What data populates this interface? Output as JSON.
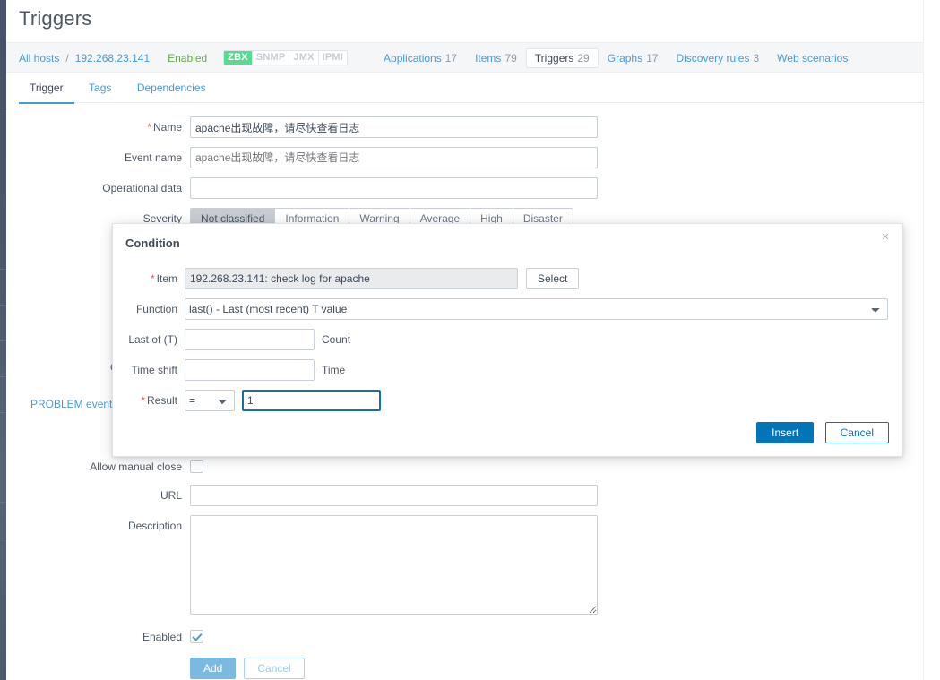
{
  "page": {
    "title": "Triggers"
  },
  "hostbar": {
    "all_hosts": "All hosts",
    "separator": "/",
    "host": "192.268.23.141",
    "status": "Enabled",
    "interfaces": [
      {
        "label": "ZBX",
        "active": true
      },
      {
        "label": "SNMP",
        "active": false
      },
      {
        "label": "JMX",
        "active": false
      },
      {
        "label": "IPMI",
        "active": false
      }
    ],
    "nav": [
      {
        "label": "Applications",
        "count": "17",
        "selected": false
      },
      {
        "label": "Items",
        "count": "79",
        "selected": false
      },
      {
        "label": "Triggers",
        "count": "29",
        "selected": true
      },
      {
        "label": "Graphs",
        "count": "17",
        "selected": false
      },
      {
        "label": "Discovery rules",
        "count": "3",
        "selected": false
      },
      {
        "label": "Web scenarios",
        "count": "",
        "selected": false
      }
    ]
  },
  "tabs": [
    {
      "label": "Trigger",
      "active": true
    },
    {
      "label": "Tags",
      "active": false
    },
    {
      "label": "Dependencies",
      "active": false
    }
  ],
  "form": {
    "name_label": "Name",
    "name_value": "apache出现故障，请尽快查看日志",
    "event_name_label": "Event name",
    "event_name_placeholder": "apache出现故障，请尽快查看日志",
    "operational_data_label": "Operational data",
    "operational_data_value": "",
    "severity_label": "Severity",
    "severity_options": [
      {
        "label": "Not classified",
        "selected": true
      },
      {
        "label": "Information",
        "selected": false
      },
      {
        "label": "Warning",
        "selected": false
      },
      {
        "label": "Average",
        "selected": false
      },
      {
        "label": "High",
        "selected": false
      },
      {
        "label": "Disaster",
        "selected": false
      }
    ],
    "ok_event_label": "OK",
    "problem_event_label": "PROBLEM event",
    "allow_manual_close_label": "Allow manual close",
    "allow_manual_close_checked": false,
    "url_label": "URL",
    "url_value": "",
    "description_label": "Description",
    "description_value": "",
    "enabled_label": "Enabled",
    "enabled_checked": true,
    "add_button": "Add",
    "cancel_button": "Cancel"
  },
  "modal": {
    "title": "Condition",
    "close_icon": "×",
    "item_label": "Item",
    "item_value": "192.268.23.141: check log for apache",
    "select_button": "Select",
    "function_label": "Function",
    "function_value": "last() - Last (most recent) T value",
    "last_of_label": "Last of (T)",
    "last_of_value": "",
    "last_of_suffix": "Count",
    "time_shift_label": "Time shift",
    "time_shift_value": "",
    "time_shift_suffix": "Time",
    "result_label": "Result",
    "result_operator": "=",
    "result_value": "1",
    "insert_button": "Insert",
    "cancel_button": "Cancel"
  },
  "colors": {
    "link": "#4a9ad4",
    "enabled_green": "#6aa84f",
    "zbx_badge": "#59db8f",
    "primary_button": "#0275b8",
    "required_asterisk": "#d65e5e",
    "sidebar": "#4d5a6b"
  }
}
